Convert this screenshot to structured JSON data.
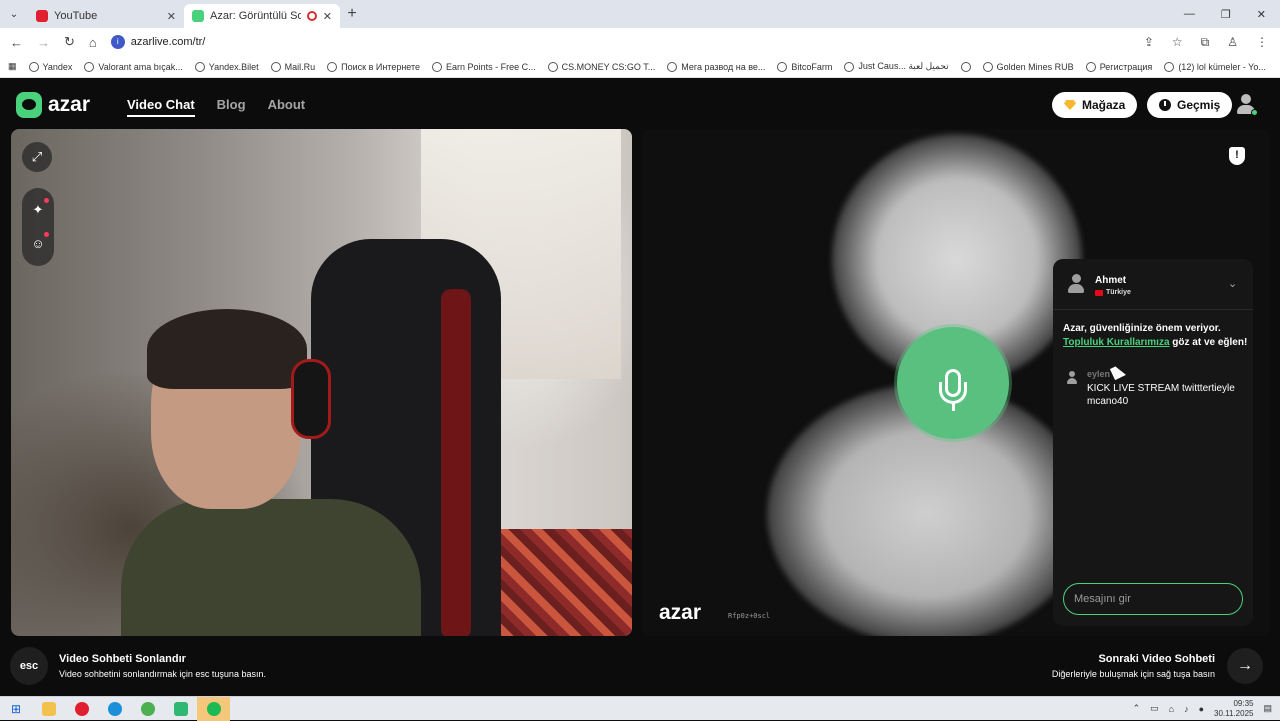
{
  "browser": {
    "tabs": [
      {
        "title": "YouTube",
        "active": false,
        "favicon_color": "#e0202e"
      },
      {
        "title": "Azar: Görüntülü Sohbet, Ye",
        "active": true,
        "favicon_color": "#49d17c"
      }
    ],
    "url": "azarlive.com/tr/",
    "bookmarks": [
      "Yandex",
      "Valorant ama bıçak...",
      "Yandex.Bilet",
      "Mail.Ru",
      "Поиск в Интернете",
      "Earn Points - Free C...",
      "CS.MONEY CS:GO T...",
      "Мега развод на ве...",
      "BitcoFarm",
      "Just Caus... تحميل لعبة",
      "",
      "Golden Mines RUB",
      "Регистрация",
      "(12) lol kümeler - Yo..."
    ]
  },
  "header": {
    "logo": "azar",
    "nav": [
      {
        "label": "Video Chat",
        "active": true
      },
      {
        "label": "Blog",
        "active": false
      },
      {
        "label": "About",
        "active": false
      }
    ],
    "store_label": "Mağaza",
    "history_label": "Geçmiş"
  },
  "right_video": {
    "logo": "azar",
    "code": "Rfp0z+0scl"
  },
  "chat": {
    "partner_name": "Ahmet",
    "partner_country": "Türkiye",
    "safety_text_1": "Azar, güvenliğinize önem veriyor.",
    "safety_link": "Topluluk Kurallarımıza",
    "safety_text_2": "göz at ve eğlen!",
    "message": {
      "sender": "eylen",
      "text": "KICK LIVE STREAM twitttertieyle mcano40"
    },
    "input_placeholder": "Mesajını gir"
  },
  "bottom": {
    "esc_label": "esc",
    "end_title": "Video Sohbeti Sonlandır",
    "end_subtitle": "Video sohbetini sonlandırmak için esc tuşuna basın.",
    "next_title": "Sonraki Video Sohbeti",
    "next_subtitle": "Diğerleriyle buluşmak için sağ tuşa basın"
  },
  "taskbar": {
    "time": "09:35",
    "date": "30.11.2025"
  },
  "colors": {
    "accent": "#49d17c",
    "mic": "#59c080",
    "background": "#0c0c0c"
  }
}
